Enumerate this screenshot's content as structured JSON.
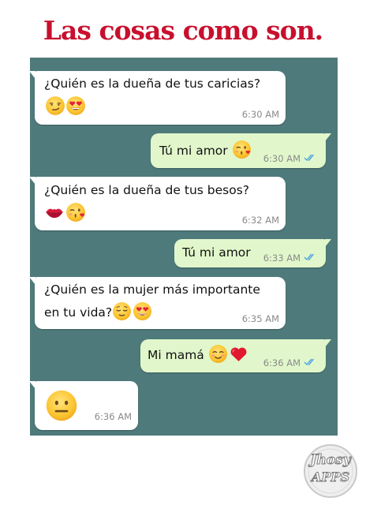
{
  "title": "Las cosas como son.",
  "colors": {
    "title": "#c8102e",
    "chat_background": "#4e7a7b",
    "incoming_bubble": "#ffffff",
    "outgoing_bubble": "#e1f7cb",
    "read_ticks": "#4fa3e0"
  },
  "messages": [
    {
      "direction": "incoming",
      "text": "¿Quién es la dueña de tus caricias?",
      "emojis": [
        "smirk",
        "heart-eyes"
      ],
      "time": "6:30 AM"
    },
    {
      "direction": "outgoing",
      "text": "Tú mi amor",
      "emojis": [
        "kiss-wink"
      ],
      "time": "6:30 AM",
      "status": "read"
    },
    {
      "direction": "incoming",
      "text": "¿Quién es la dueña de tus besos?",
      "emojis": [
        "kiss-lips",
        "kiss-wink"
      ],
      "time": "6:32 AM"
    },
    {
      "direction": "outgoing",
      "text": "Tú mi amor",
      "emojis": [],
      "time": "6:33 AM",
      "status": "read"
    },
    {
      "direction": "incoming",
      "text_line1": "¿Quién es la mujer más importante",
      "text_line2": "en tu vida?",
      "emojis": [
        "relieved",
        "heart-eyes"
      ],
      "time": "6:35 AM"
    },
    {
      "direction": "outgoing",
      "text": "Mi mamá",
      "emojis": [
        "blush",
        "red-heart"
      ],
      "time": "6:36 AM",
      "status": "read"
    },
    {
      "direction": "incoming",
      "text": "",
      "emojis": [
        "neutral-face"
      ],
      "time": "6:36 AM"
    }
  ],
  "watermark": {
    "line1": "Jhosy",
    "line2": "APPS"
  }
}
